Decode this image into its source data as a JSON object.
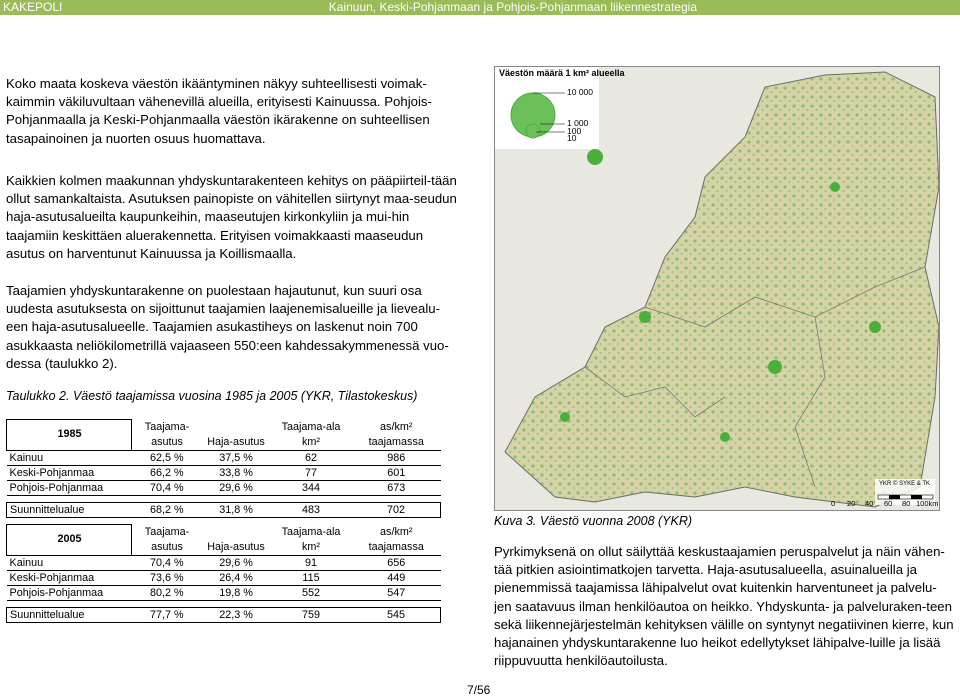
{
  "header": {
    "left": "KAKEPOLI",
    "right": "Kainuun, Keski-Pohjanmaan ja Pohjois-Pohjanmaan liikennestrategia"
  },
  "paragraphs": {
    "p1": "Koko maata koskeva väestön ikääntyminen näkyy suhteellisesti voimak-kaimmin väkiluvultaan vähenevillä alueilla, erityisesti Kainuussa. Pohjois-Pohjanmaalla ja Keski-Pohjanmaalla väestön ikärakenne on suhteellisen tasapainoinen ja nuorten osuus huomattava.",
    "p2": "Kaikkien kolmen maakunnan yhdyskuntarakenteen kehitys on pääpiirteil-tään ollut samankaltaista. Asutuksen painopiste on vähitellen siirtynyt maa-seudun haja-asutusalueilta kaupunkeihin, maaseutujen kirkonkyliin ja mui-hin taajamiin keskittäen aluerakennetta. Erityisen voimakkaasti maaseudun asutus on harventunut Kainuussa ja Koillismaalla.",
    "p3": "Taajamien yhdyskuntarakenne on puolestaan hajautunut, kun suuri osa uudesta asutuksesta on sijoittunut taajamien laajenemisalueille ja lievealu-een haja-asutusalueelle. Taajamien asukastiheys on laskenut noin 700 asukkaasta neliökilometrillä vajaaseen 550:een kahdessakymmenessä vuo-dessa (taulukko 2).",
    "p4": "Pyrkimyksenä on ollut säilyttää keskustaajamien peruspalvelut ja näin vähen-tää pitkien asiointimatkojen tarvetta. Haja-asutusalueella, asuinalueilla ja pienemmissä taajamissa lähipalvelut ovat kuitenkin harventuneet ja palvelu-jen saatavuus ilman henkilöautoa on heikko. Yhdyskunta- ja palveluraken-teen sekä liikennejärjestelmän kehityksen välille on syntynyt negatiivinen kierre, kun hajanainen yhdyskuntarakenne luo heikot edellytykset lähipalve-luille ja lisää riippuvuutta henkilöautoilusta."
  },
  "table_caption": "Taulukko 2. Väestö taajamissa vuosina 1985 ja 2005 (YKR, Tilastokeskus)",
  "table_headers": {
    "c1a": "Taajama-",
    "c1b": "asutus",
    "c2": "Haja-asutus",
    "c3a": "Taajama-ala",
    "c3b": "km²",
    "c4a": "as/km²",
    "c4b": "taajamassa"
  },
  "table_1985": {
    "year": "1985",
    "rows": [
      [
        "Kainuu",
        "62,5 %",
        "37,5 %",
        "62",
        "986"
      ],
      [
        "Keski-Pohjanmaa",
        "66,2 %",
        "33,8 %",
        "77",
        "601"
      ],
      [
        "Pohjois-Pohjanmaa",
        "70,4 %",
        "29,6 %",
        "344",
        "673"
      ]
    ],
    "total": [
      "Suunnittelualue",
      "68,2 %",
      "31,8 %",
      "483",
      "702"
    ]
  },
  "table_2005": {
    "year": "2005",
    "rows": [
      [
        "Kainuu",
        "70,4 %",
        "29,6 %",
        "91",
        "656"
      ],
      [
        "Keski-Pohjanmaa",
        "73,6 %",
        "26,4 %",
        "115",
        "449"
      ],
      [
        "Pohjois-Pohjanmaa",
        "80,2 %",
        "19,8 %",
        "552",
        "547"
      ]
    ],
    "total": [
      "Suunnittelualue",
      "77,7 %",
      "22,3 %",
      "759",
      "545"
    ]
  },
  "map": {
    "legend_title": "Väestön määrä 1 km² alueella",
    "legend_values": [
      "10 000",
      "1 000",
      "100",
      "10"
    ],
    "credit": "YKR © SYKE & TK",
    "scale_labels": [
      "0",
      "20",
      "40",
      "60",
      "80",
      "100km"
    ],
    "region_color": "#d8d2a8",
    "dot_color": "#4caf3c"
  },
  "map_caption": "Kuva 3. Väestö vuonna 2008 (YKR)",
  "page_number": "7/56"
}
